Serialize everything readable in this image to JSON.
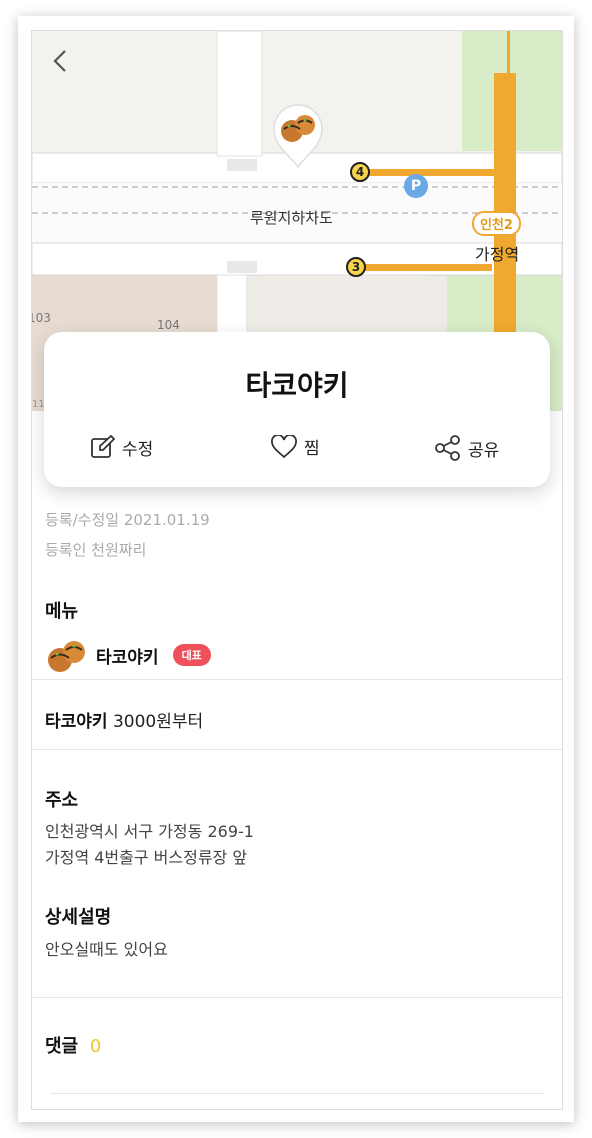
{
  "map": {
    "road_label": "루원지하차도",
    "station_name": "가정역",
    "line_badge": "인천2",
    "exit_4": "4",
    "exit_3": "3",
    "parking": "P",
    "building_103": "103",
    "building_104": "104",
    "building_11": "11"
  },
  "card": {
    "title": "타코야키",
    "edit_label": "수정",
    "like_label": "찜",
    "share_label": "공유"
  },
  "info": {
    "date_line": "등록/수정일 2021.01.19",
    "author_line": "등록인 천원짜리"
  },
  "menu": {
    "title": "메뉴",
    "item_name": "타코야키",
    "rep_badge": "대표",
    "price_name": "타코야키",
    "price_value": "3000원부터"
  },
  "address": {
    "title": "주소",
    "line1": "인천광역시 서구 가정동 269-1",
    "line2": "가정역 4번출구 버스정류장 앞"
  },
  "detail": {
    "title": "상세설명",
    "text": "안오실때도 있어요"
  },
  "comments": {
    "title": "댓글",
    "count": "0"
  },
  "colors": {
    "accent_yellow": "#f4c430",
    "badge_red": "#f0505a",
    "subway_orange": "#f0a830",
    "park_green": "#d8ecc8"
  }
}
